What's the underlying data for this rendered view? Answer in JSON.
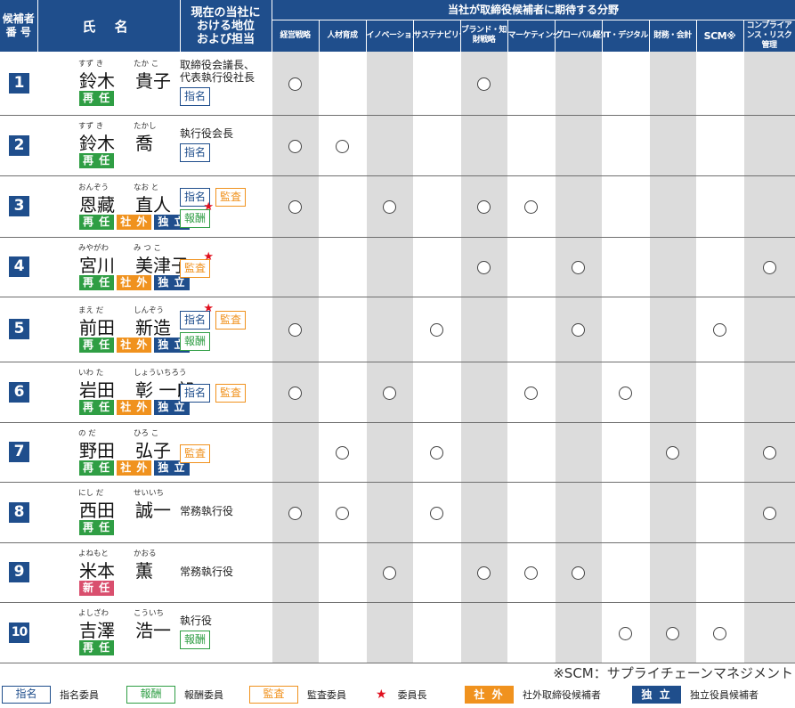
{
  "header": {
    "num": "候補者\n番 号",
    "name": "氏 名",
    "position": "現在の当社に\nおける地位\nおよび担当",
    "areas_title": "当社が取締役候補者に期待する分野"
  },
  "areas": [
    "経営戦略",
    "人材育成",
    "イノベーション",
    "サステナビリティ",
    "ブランド・知財戦略",
    "マーケティング",
    "グローバル経営",
    "IT・デジタル",
    "財務・会計",
    "SCM※",
    "コンプライアンス・リスク管理"
  ],
  "labels": {
    "reappointed": "再 任",
    "new": "新 任",
    "outside": "社 外",
    "independent": "独 立",
    "nomination": "指名",
    "remuneration": "報酬",
    "audit": "監査"
  },
  "candidates": [
    {
      "no": "1",
      "ruby1": "すず き",
      "ruby2": "たか こ",
      "name1": "鈴木",
      "name2": "貴子",
      "status": "再任",
      "outside": false,
      "independent": false,
      "position": "取締役会議長、\n代表執行役社長",
      "committees": [
        {
          "type": "nomination",
          "chair": false
        }
      ],
      "areas": [
        true,
        false,
        false,
        false,
        true,
        false,
        false,
        false,
        false,
        false,
        false
      ]
    },
    {
      "no": "2",
      "ruby1": "すず き",
      "ruby2": "たかし",
      "name1": "鈴木",
      "name2": "喬",
      "status": "再任",
      "outside": false,
      "independent": false,
      "position": "執行役会長",
      "committees": [
        {
          "type": "nomination",
          "chair": false
        }
      ],
      "areas": [
        true,
        true,
        false,
        false,
        false,
        false,
        false,
        false,
        false,
        false,
        false
      ]
    },
    {
      "no": "3",
      "ruby1": "おんぞう",
      "ruby2": "なお と",
      "name1": "恩藏",
      "name2": "直人",
      "status": "再任",
      "outside": true,
      "independent": true,
      "position": "",
      "committees": [
        {
          "type": "nomination",
          "chair": false
        },
        {
          "type": "audit",
          "chair": false
        },
        {
          "type": "remuneration",
          "chair": true
        }
      ],
      "areas": [
        true,
        false,
        true,
        false,
        true,
        true,
        false,
        false,
        false,
        false,
        false
      ]
    },
    {
      "no": "4",
      "ruby1": "みやがわ",
      "ruby2": "み つ こ",
      "name1": "宮川",
      "name2": "美津子",
      "status": "再任",
      "outside": true,
      "independent": true,
      "position": "",
      "committees": [
        {
          "type": "audit",
          "chair": true
        }
      ],
      "areas": [
        false,
        false,
        false,
        false,
        true,
        false,
        true,
        false,
        false,
        false,
        true
      ]
    },
    {
      "no": "5",
      "ruby1": "まえ だ",
      "ruby2": "しんぞう",
      "name1": "前田",
      "name2": "新造",
      "status": "再任",
      "outside": true,
      "independent": true,
      "position": "",
      "committees": [
        {
          "type": "nomination",
          "chair": true
        },
        {
          "type": "audit",
          "chair": false
        },
        {
          "type": "remuneration",
          "chair": false
        }
      ],
      "areas": [
        true,
        false,
        false,
        true,
        false,
        false,
        true,
        false,
        false,
        true,
        false
      ]
    },
    {
      "no": "6",
      "ruby1": "いわ た",
      "ruby2": "しょういちろう",
      "name1": "岩田",
      "name2": "彰 一郎",
      "status": "再任",
      "outside": true,
      "independent": true,
      "position": "",
      "committees": [
        {
          "type": "nomination",
          "chair": false
        },
        {
          "type": "audit",
          "chair": false
        }
      ],
      "areas": [
        true,
        false,
        true,
        false,
        false,
        true,
        false,
        true,
        false,
        false,
        false
      ]
    },
    {
      "no": "7",
      "ruby1": "の だ",
      "ruby2": "ひろ こ",
      "name1": "野田",
      "name2": "弘子",
      "status": "再任",
      "outside": true,
      "independent": true,
      "position": "",
      "committees": [
        {
          "type": "audit",
          "chair": false
        }
      ],
      "areas": [
        false,
        true,
        false,
        true,
        false,
        false,
        false,
        false,
        true,
        false,
        true
      ]
    },
    {
      "no": "8",
      "ruby1": "にし だ",
      "ruby2": "せいいち",
      "name1": "西田",
      "name2": "誠一",
      "status": "再任",
      "outside": false,
      "independent": false,
      "position": "常務執行役",
      "committees": [],
      "areas": [
        true,
        true,
        false,
        true,
        false,
        false,
        false,
        false,
        false,
        false,
        true
      ]
    },
    {
      "no": "9",
      "ruby1": "よねもと",
      "ruby2": "かおる",
      "name1": "米本",
      "name2": "薫",
      "status": "新任",
      "outside": false,
      "independent": false,
      "position": "常務執行役",
      "committees": [],
      "areas": [
        false,
        false,
        true,
        false,
        true,
        true,
        true,
        false,
        false,
        false,
        false
      ]
    },
    {
      "no": "10",
      "ruby1": "よしざわ",
      "ruby2": "こういち",
      "name1": "吉澤",
      "name2": "浩一",
      "status": "再任",
      "outside": false,
      "independent": false,
      "position": "執行役",
      "committees": [
        {
          "type": "remuneration",
          "chair": false
        }
      ],
      "areas": [
        false,
        false,
        false,
        false,
        false,
        false,
        false,
        true,
        true,
        true,
        false
      ]
    }
  ],
  "footnote": "※SCM：サプライチェーンマネジメント",
  "legend": {
    "nomination_box": "指名",
    "nomination_text": "指名委員",
    "remuneration_box": "報酬",
    "remuneration_text": "報酬委員",
    "audit_box": "監査",
    "audit_text": "監査委員",
    "star_text": "委員長",
    "outside_box": "社 外",
    "outside_text": "社外取締役候補者",
    "independent_box": "独 立",
    "independent_text": "独立役員候補者"
  },
  "colors": {
    "navy": "#1f4e8c",
    "green": "#2f9e44",
    "orange": "#f0921e",
    "pink": "#d94f6e",
    "star": "#e0101e",
    "shade": "#dcdcdc"
  },
  "icons": {
    "chair": "star-icon",
    "mark": "circle-icon"
  }
}
